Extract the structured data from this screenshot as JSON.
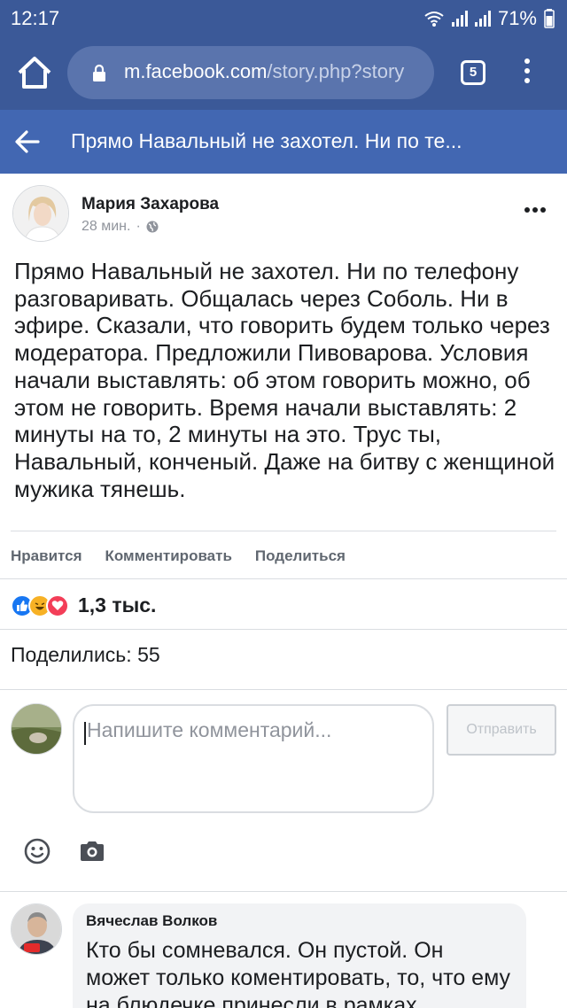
{
  "status_bar": {
    "time": "12:17",
    "battery": "71%"
  },
  "browser": {
    "url_domain": "m.facebook.com",
    "url_path": "/story.php?story",
    "tab_count": "5"
  },
  "header": {
    "title": "Прямо Навальный не захотел. Ни по те..."
  },
  "post": {
    "author": "Мария Захарова",
    "time": "28 мин.",
    "separator": "·",
    "text": "Прямо Навальный не захотел. Ни по телефону разговаривать. Общалась через Соболь. Ни в эфире. Сказали, что говорить будем только через модератора. Предложили Пивоварова. Условия начали выставлять: об этом говорить можно, об этом не говорить. Время начали выставлять: 2 минуты на то, 2 минуты на это. Трус ты, Навальный, конченый. Даже на битву с женщиной мужика тянешь.",
    "actions": {
      "like": "Нравится",
      "comment": "Комментировать",
      "share": "Поделиться"
    },
    "reaction_count": "1,3 тыс.",
    "shares": "Поделились: 55"
  },
  "composer": {
    "placeholder": "Напишите комментарий...",
    "send_label": "Отправить"
  },
  "comment": {
    "author": "Вячеслав Волков",
    "text": "Кто бы сомневался. Он пустой. Он может только коментировать, то, что ему на блюдечке принесли в рамках"
  },
  "colors": {
    "browser_bar": "#3b5998",
    "fb_header": "#4267b2",
    "like": "#1877f2",
    "haha": "#f7b125",
    "love": "#f33e58"
  }
}
